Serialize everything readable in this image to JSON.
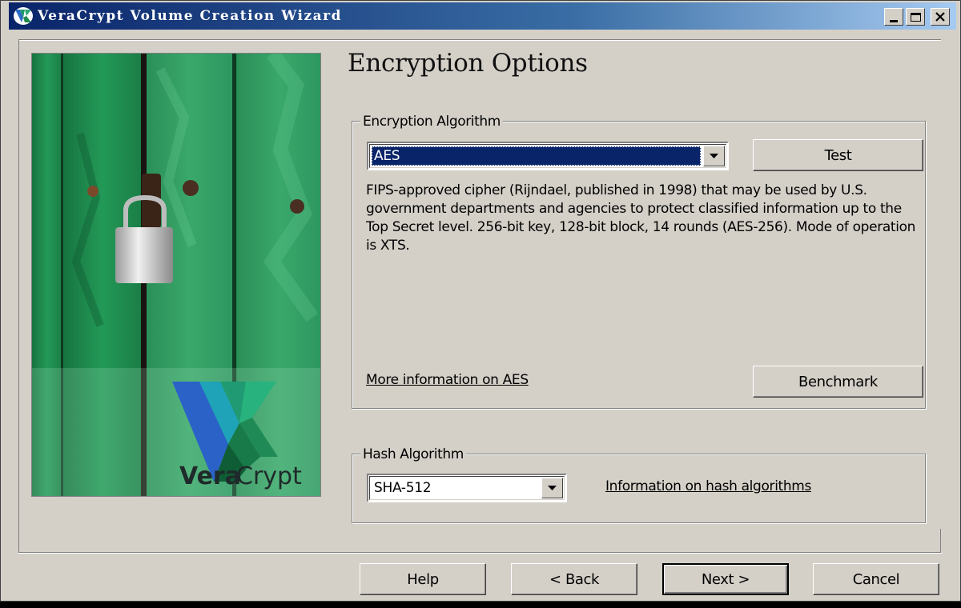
{
  "window": {
    "title": "VeraCrypt Volume Creation Wizard",
    "controls": {
      "minimize": "minimize",
      "maximize": "maximize",
      "close": "close"
    }
  },
  "banner": {
    "logo_vera": "Vera",
    "logo_crypt": "Crypt"
  },
  "page": {
    "title": "Encryption Options"
  },
  "encryption": {
    "legend": "Encryption Algorithm",
    "selected": "AES",
    "test_label": "Test",
    "description": "FIPS-approved cipher (Rijndael, published in 1998) that may be used by U.S. government departments and agencies to protect classified information up to the Top Secret level. 256-bit key, 128-bit block, 14 rounds (AES-256). Mode of operation is XTS.",
    "more_info_link": "More information on AES",
    "benchmark_label": "Benchmark"
  },
  "hash": {
    "legend": "Hash Algorithm",
    "selected": "SHA-512",
    "info_link": "Information on hash algorithms"
  },
  "footer": {
    "help_label": "Help",
    "back_label": "< Back",
    "next_label": "Next >",
    "cancel_label": "Cancel"
  },
  "colors": {
    "titlebar_start": "#0a246a",
    "titlebar_end": "#a6caf0",
    "face": "#d4d0c8",
    "selection": "#0a246a",
    "banner_green": "#1f8a4c"
  }
}
